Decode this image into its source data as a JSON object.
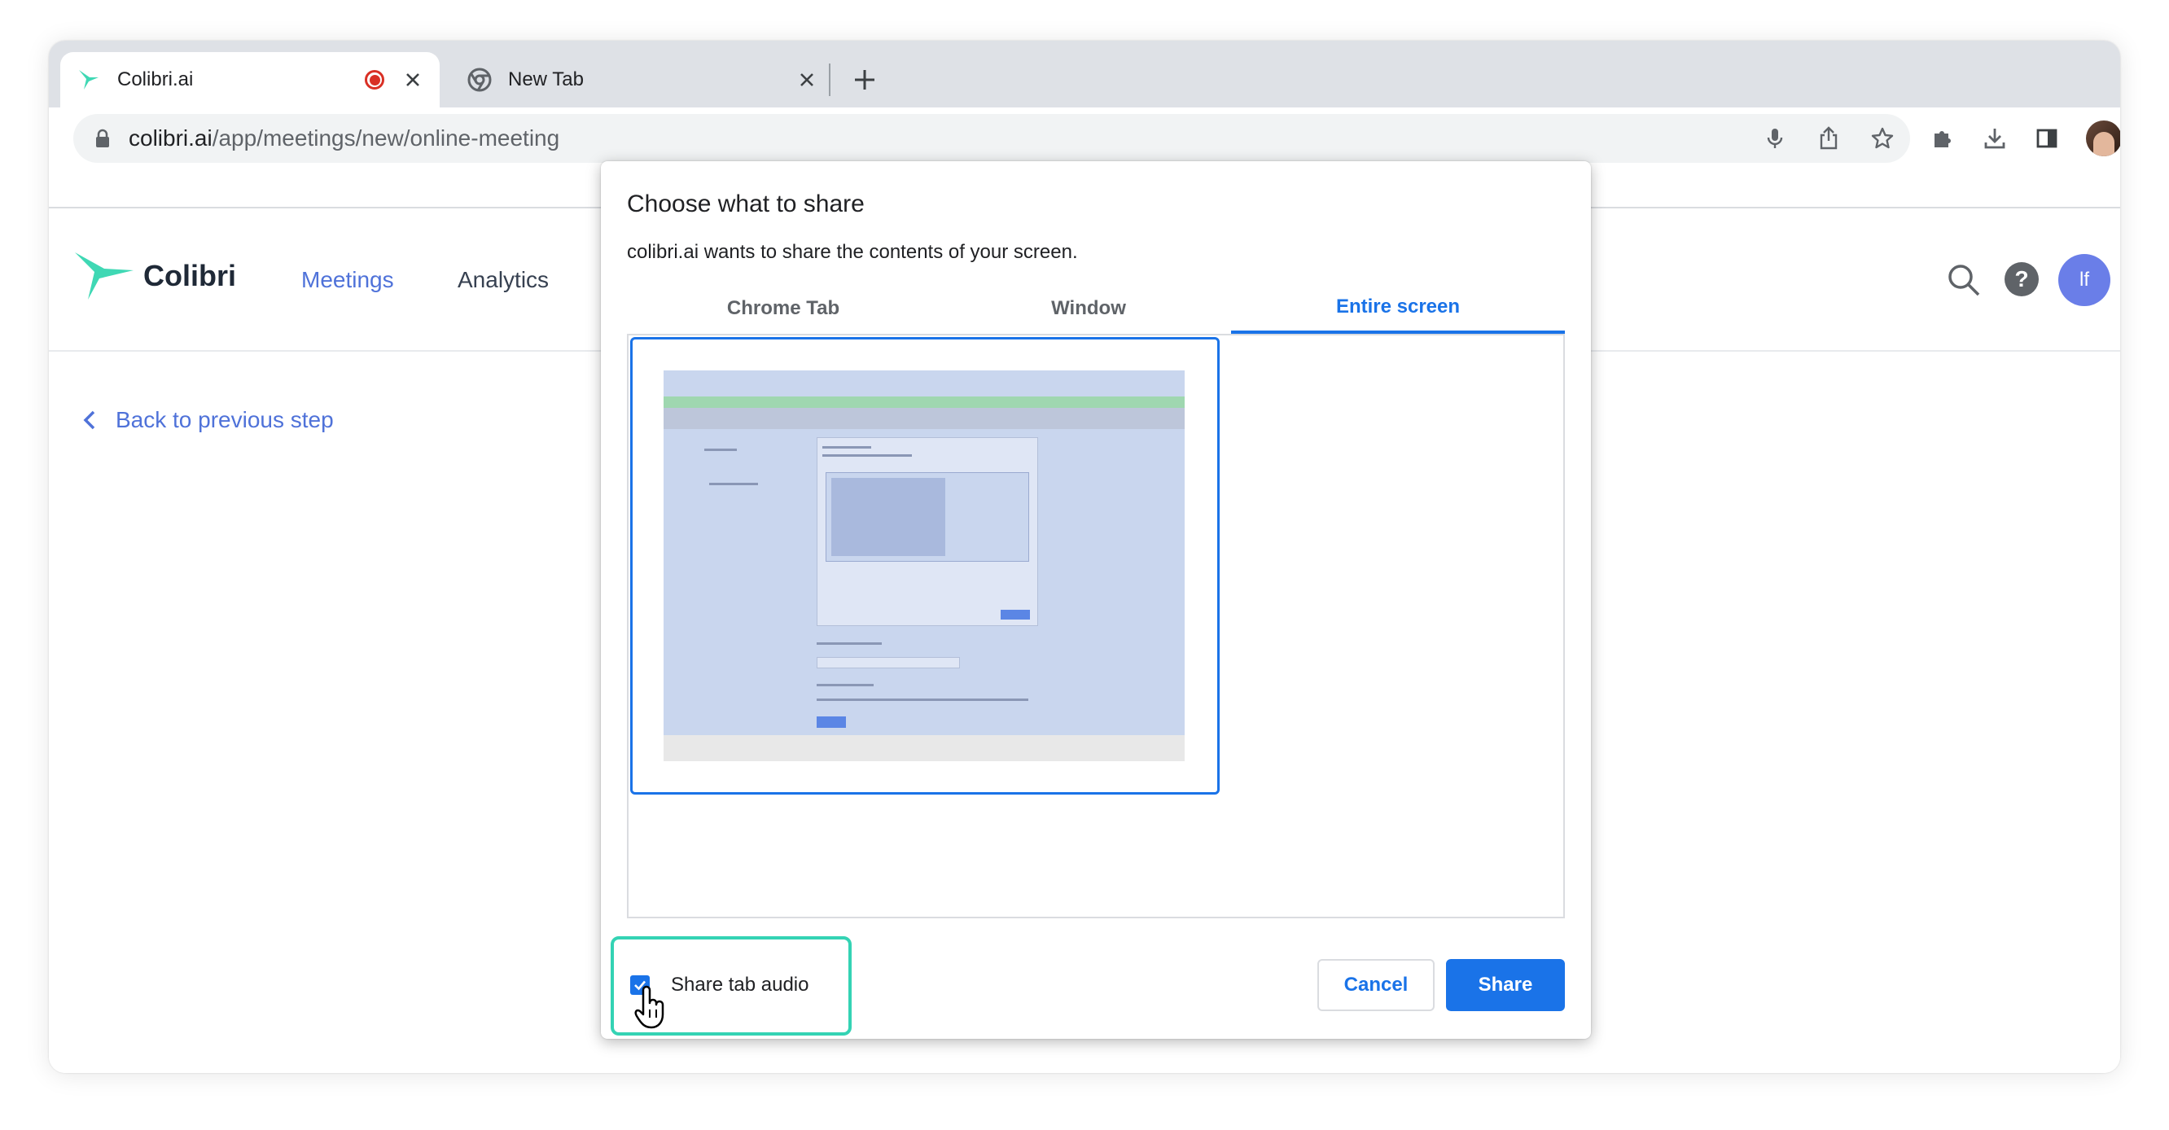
{
  "browser": {
    "tabs": [
      {
        "title": "Colibri.ai",
        "favicon": "hummingbird-icon",
        "recording": true
      },
      {
        "title": "New Tab",
        "favicon": "chrome-icon"
      }
    ],
    "omnibox": {
      "url_domain": "colibri.ai",
      "url_path": "/app/meetings/new/online-meeting"
    }
  },
  "app": {
    "logo_text": "Colibri",
    "nav": {
      "meetings": "Meetings",
      "analytics": "Analytics"
    },
    "user_initials": "lf",
    "help_glyph": "?",
    "back_link": "Back to previous step",
    "accent_color": "#4f72d9"
  },
  "dialog": {
    "title": "Choose what to share",
    "subtitle": "colibri.ai wants to share the contents of your screen.",
    "tabs": [
      "Chrome Tab",
      "Window",
      "Entire screen"
    ],
    "selected_tab": "Entire screen",
    "share_audio_label": "Share tab audio",
    "share_audio_checked": true,
    "cancel_label": "Cancel",
    "share_label": "Share",
    "highlight_color": "#34d3b4"
  }
}
